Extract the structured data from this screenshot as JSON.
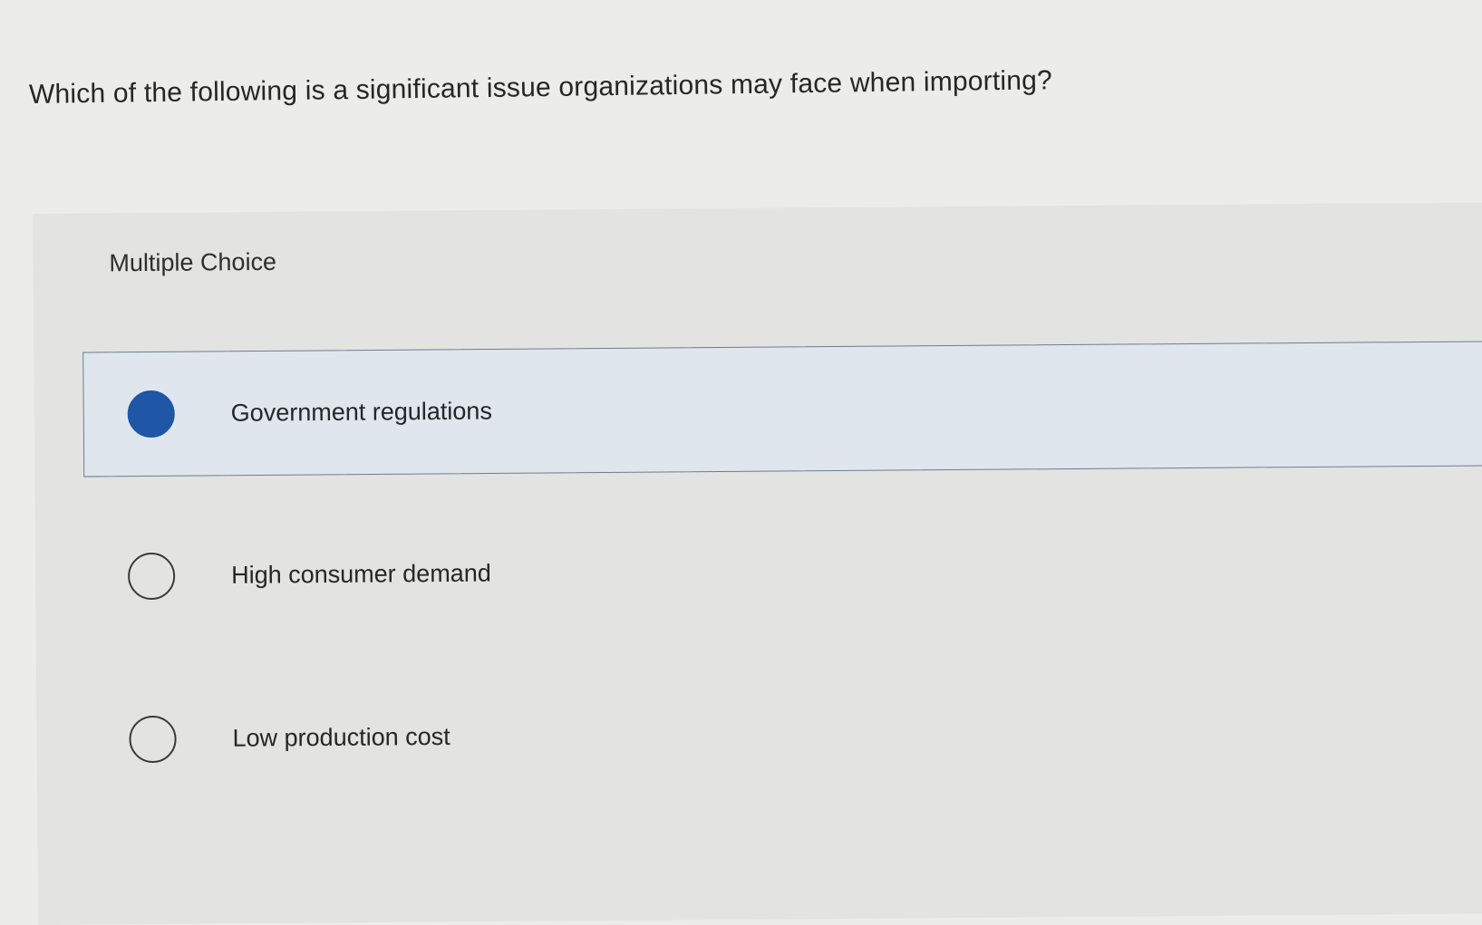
{
  "question": {
    "text": "Which of the following is a significant issue organizations may face when importing?"
  },
  "panel": {
    "label": "Multiple Choice"
  },
  "options": [
    {
      "label": "Government regulations",
      "selected": true
    },
    {
      "label": "High consumer demand",
      "selected": false
    },
    {
      "label": "Low production cost",
      "selected": false
    }
  ],
  "colors": {
    "selected_radio": "#1f56a6",
    "selected_row": "#dfe6ee"
  }
}
